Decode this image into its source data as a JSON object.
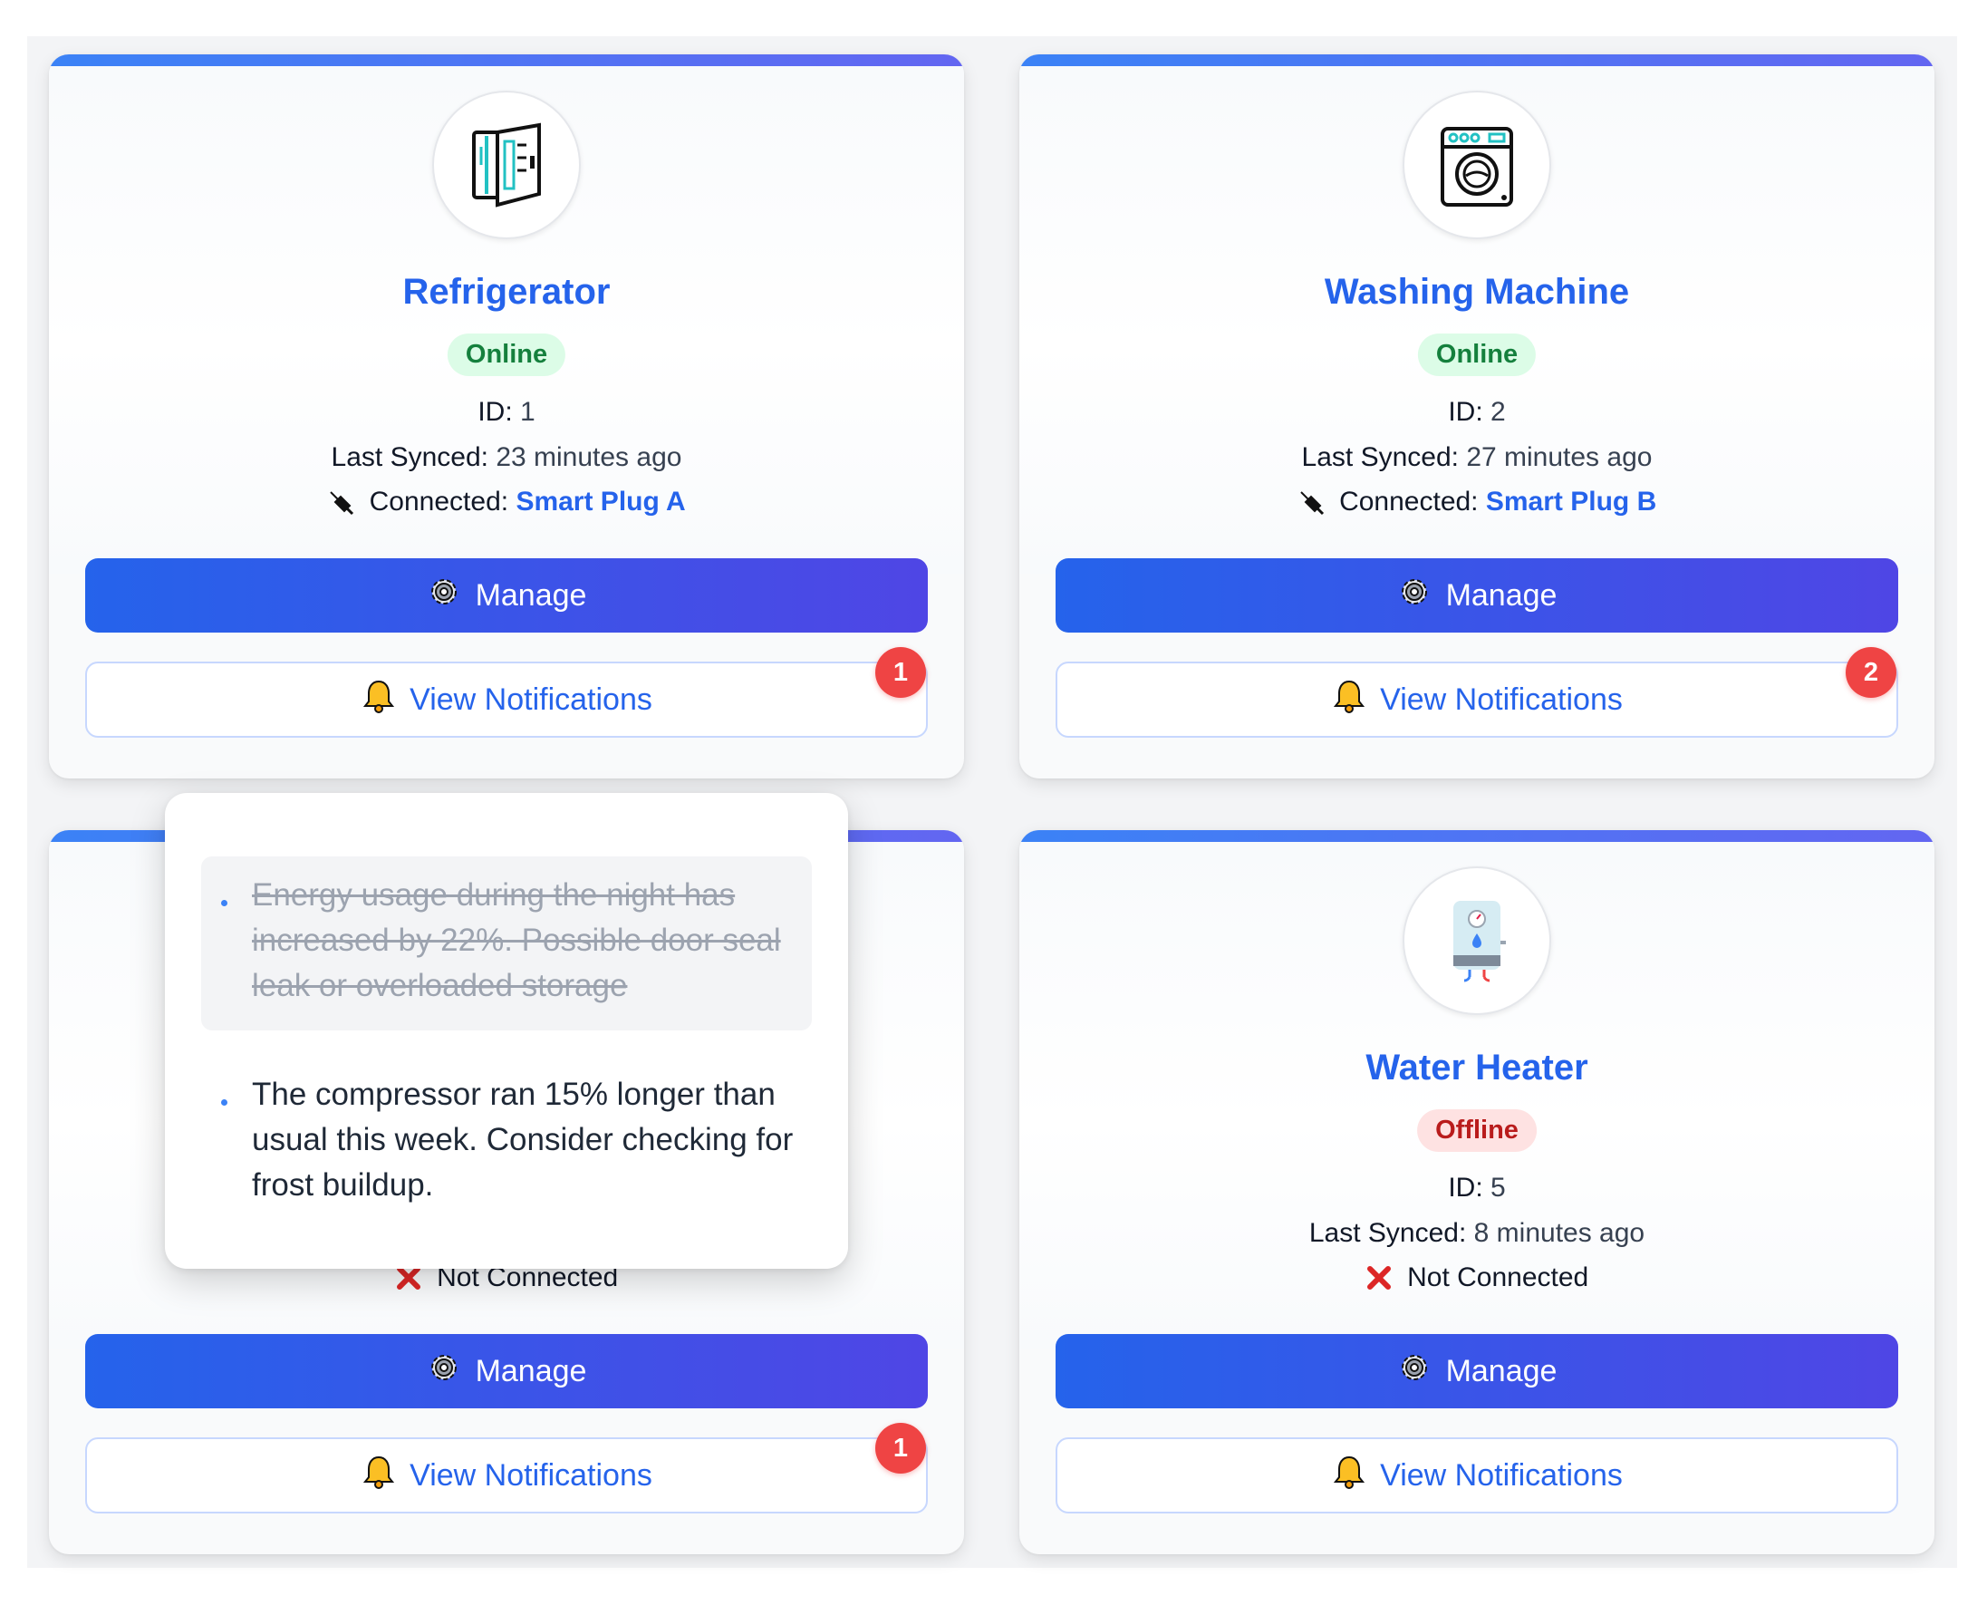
{
  "labels": {
    "id_label": "ID:",
    "synced_label": "Last Synced:",
    "connected_label": "Connected:",
    "not_connected": "Not Connected",
    "manage": "Manage",
    "view_notifications": "View Notifications"
  },
  "devices": [
    {
      "name": "Refrigerator",
      "status": "Online",
      "id": "1",
      "last_synced": "23 minutes ago",
      "connected_to": "Smart Plug A",
      "notification_count": "1",
      "icon": "refrigerator-icon"
    },
    {
      "name": "Washing Machine",
      "status": "Online",
      "id": "2",
      "last_synced": "27 minutes ago",
      "connected_to": "Smart Plug B",
      "notification_count": "2",
      "icon": "washing-machine-icon"
    },
    {
      "notification_count": "1"
    },
    {
      "name": "Water Heater",
      "status": "Offline",
      "id": "5",
      "last_synced": "8 minutes ago",
      "connected_to": null,
      "notification_count": null,
      "icon": "water-heater-icon"
    }
  ],
  "notifications_popover": {
    "items": [
      {
        "text": "Energy usage during the night has increased by 22%. Possible door seal leak or overloaded storage",
        "read": true
      },
      {
        "text": "The compressor ran 15% longer than usual this week. Consider checking for frost buildup.",
        "read": false
      }
    ]
  },
  "colors": {
    "accent": "#2563eb",
    "accent_gradient_end": "#4f46e5",
    "online_bg": "#dcfce7",
    "online_text": "#15803d",
    "offline_bg": "#fee2e2",
    "offline_text": "#b91c1c",
    "badge": "#ef4444"
  }
}
